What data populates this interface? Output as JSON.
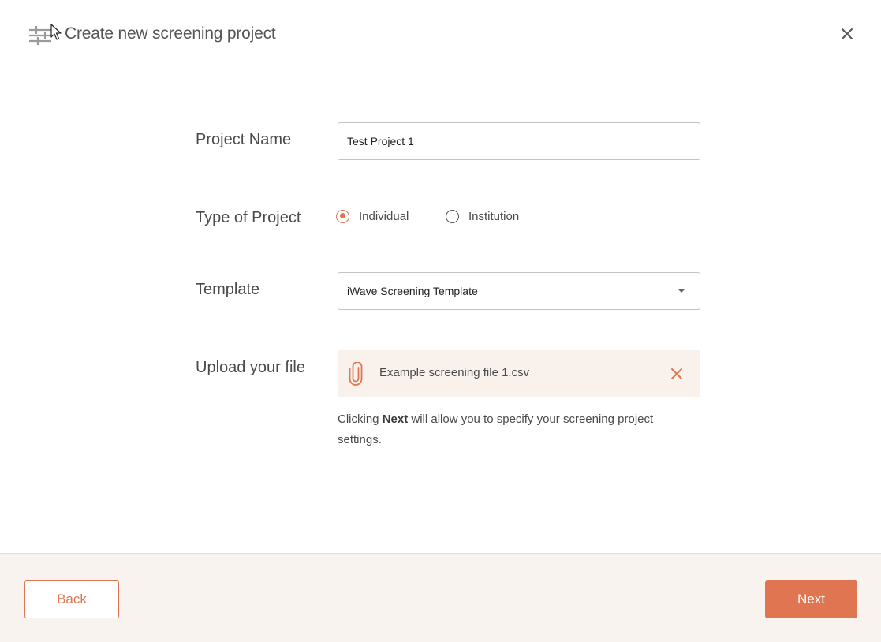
{
  "dialog": {
    "title": "Create new screening project",
    "close_icon": "close-icon",
    "header_icon": "sliders-icon"
  },
  "form": {
    "project_name": {
      "label": "Project Name",
      "value": "Test Project 1"
    },
    "project_type": {
      "label": "Type of Project",
      "options": [
        {
          "label": "Individual",
          "selected": true
        },
        {
          "label": "Institution",
          "selected": false
        }
      ]
    },
    "template": {
      "label": "Template",
      "selected": "iWave Screening Template"
    },
    "upload": {
      "label": "Upload your file",
      "file_name": "Example screening file 1.csv",
      "attach_icon": "paperclip-icon",
      "remove_icon": "remove-file-icon"
    },
    "hint": {
      "prefix": "Clicking ",
      "emphasis": "Next",
      "suffix": " will allow you to specify your screening project settings."
    }
  },
  "footer": {
    "back_label": "Back",
    "next_label": "Next"
  },
  "colors": {
    "accent": "#e07552",
    "footer_bg": "#f8f3ef",
    "file_bg": "#f8f1ec",
    "text": "#4a4a4a"
  }
}
